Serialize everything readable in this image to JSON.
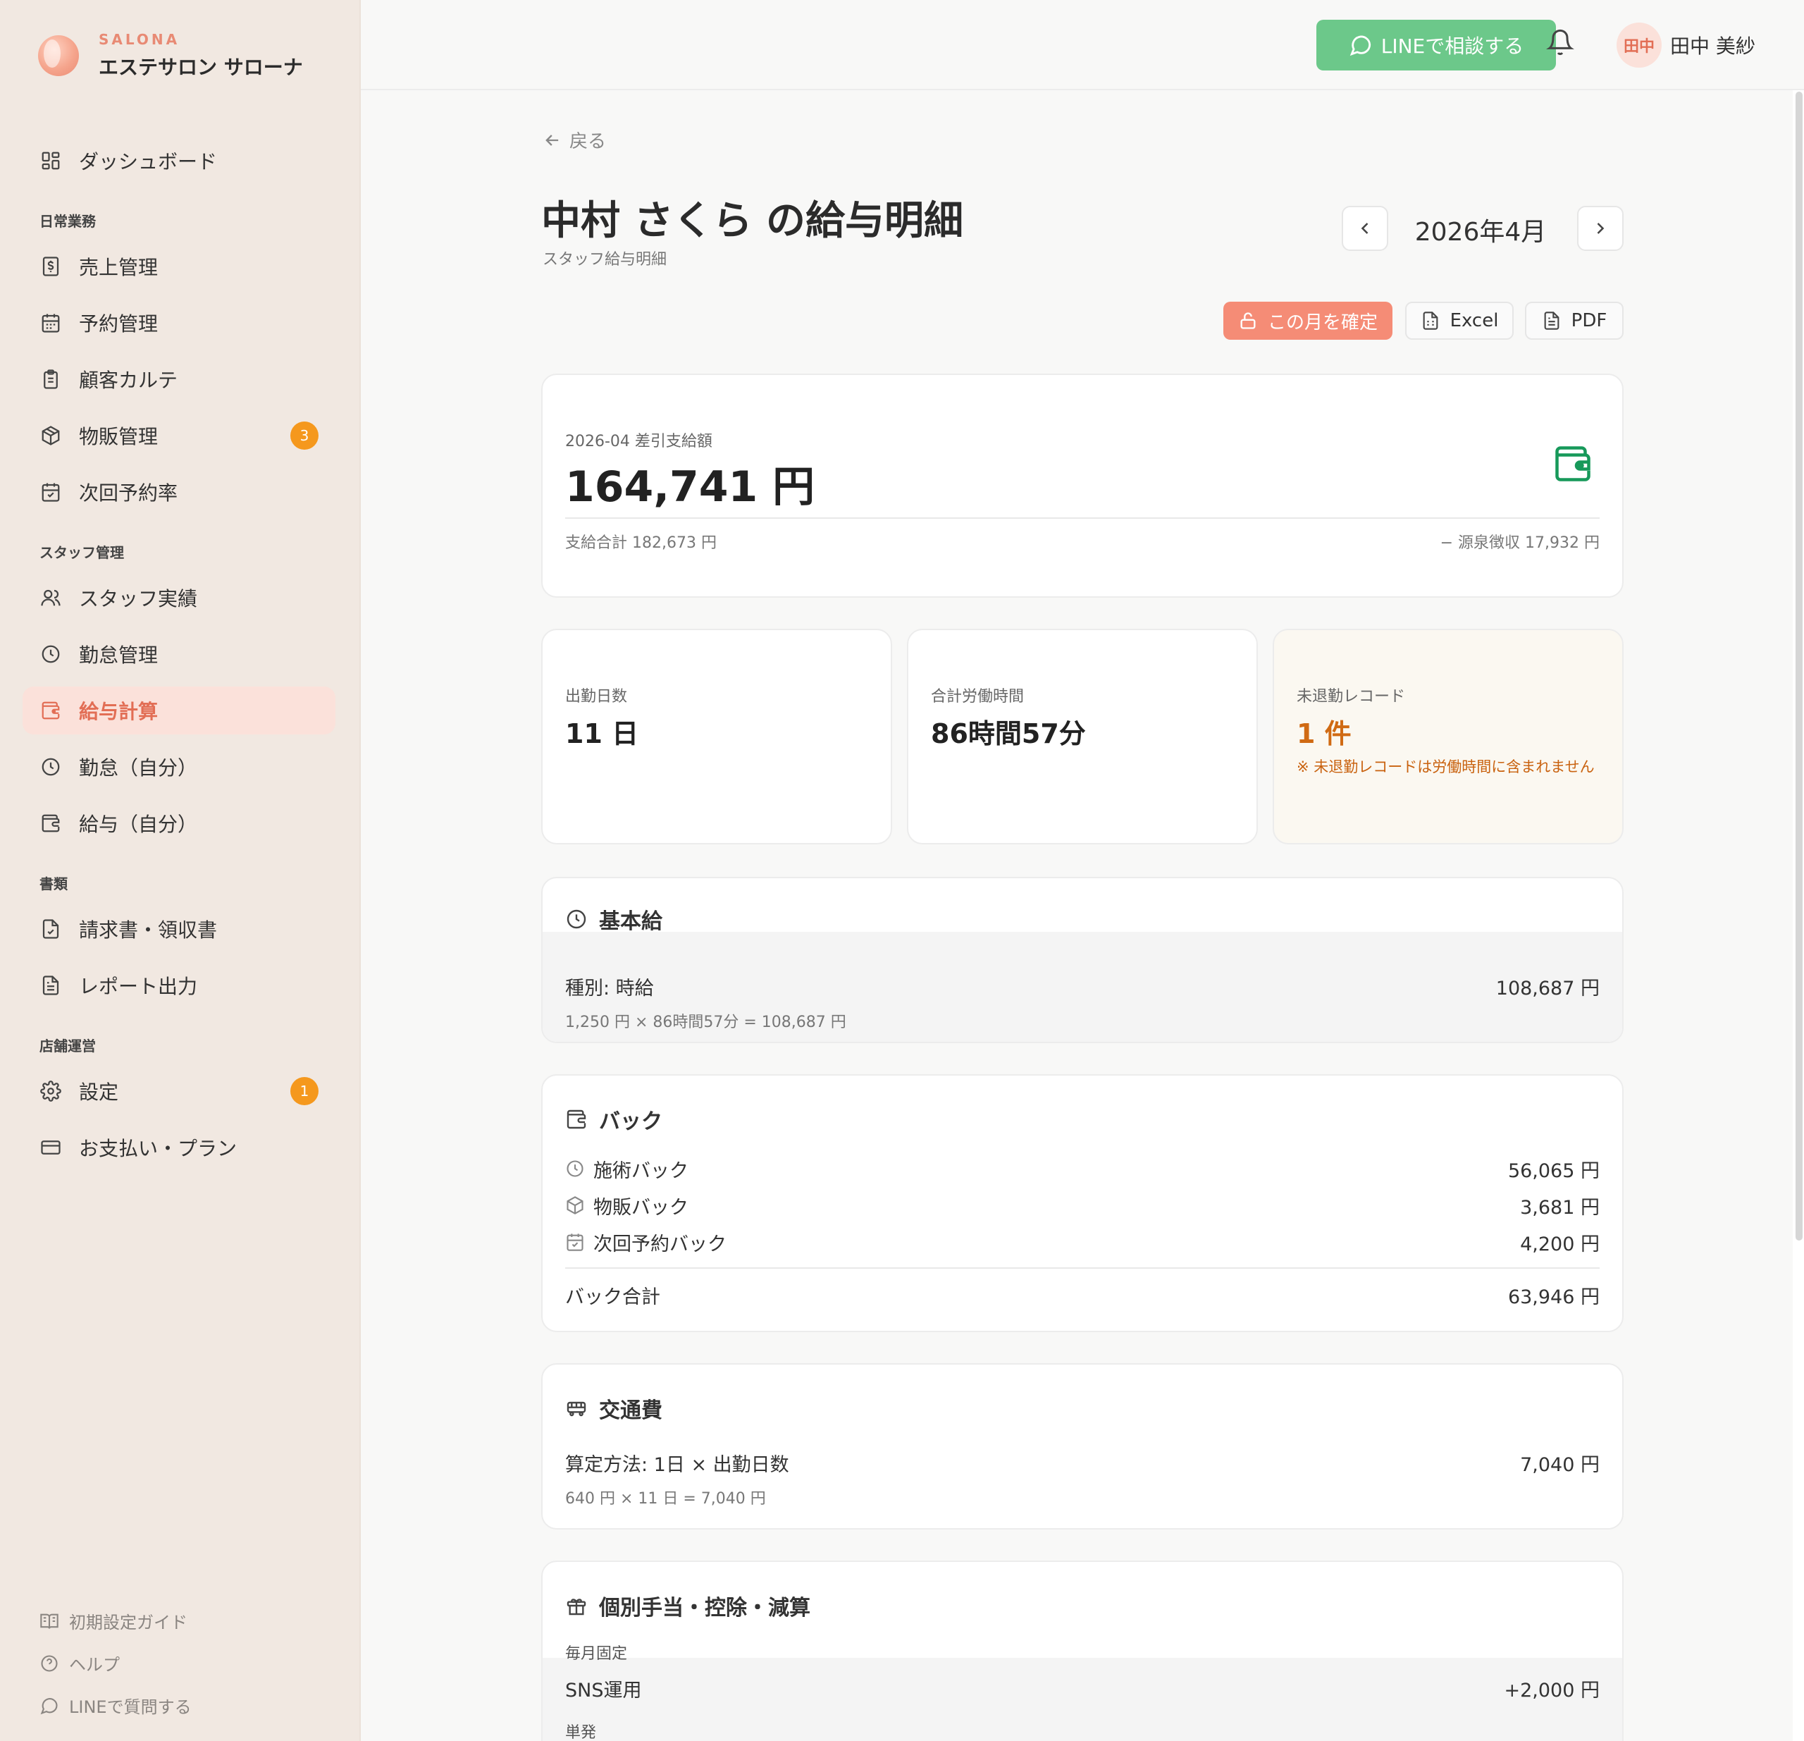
{
  "colors": {
    "accent": "#e26e55",
    "line_green": "#6cc88a",
    "badge": "#f5981d",
    "warn": "#d06a13"
  },
  "brand": {
    "small": "SALONA",
    "name": "エステサロン サローナ"
  },
  "nav": {
    "dashboard": "ダッシュボード",
    "section_daily": "日常業務",
    "sales": "売上管理",
    "reservations": "予約管理",
    "karte": "顧客カルテ",
    "merch": "物販管理",
    "merch_badge": "3",
    "next_rate": "次回予約率",
    "section_staff": "スタッフ管理",
    "staff_perf": "スタッフ実績",
    "attendance": "勤怠管理",
    "payroll": "給与計算",
    "attendance_self": "勤怠（自分）",
    "payroll_self": "給与（自分）",
    "section_docs": "書類",
    "invoices": "請求書・領収書",
    "reports": "レポート出力",
    "section_store": "店舗運営",
    "settings": "設定",
    "settings_badge": "1",
    "billing": "お支払い・プラン"
  },
  "footer": {
    "guide": "初期設定ガイド",
    "help": "ヘルプ",
    "line_ask": "LINEで質問する"
  },
  "topbar": {
    "line_button": "LINEで相談する",
    "avatar": "田中",
    "user_name": "田中 美紗"
  },
  "page": {
    "back": "戻る",
    "title": "中村 さくら の給与明細",
    "subtitle": "スタッフ給与明細",
    "month": "2026年4月",
    "confirm": "この月を確定",
    "excel": "Excel",
    "pdf": "PDF"
  },
  "net": {
    "label": "2026-04 差引支給額",
    "amount": "164,741 円",
    "gross": "支給合計 182,673 円",
    "tax": "− 源泉徴収 17,932 円"
  },
  "stats": {
    "days_label": "出勤日数",
    "days_value": "11 日",
    "hours_label": "合計労働時間",
    "hours_value": "86時間57分",
    "open_label": "未退勤レコード",
    "open_value": "1 件",
    "open_note": "※ 未退勤レコードは労働時間に含まれません"
  },
  "base": {
    "title": "基本給",
    "type_label": "種別: 時給",
    "amount": "108,687 円",
    "formula": "1,250 円 × 86時間57分 = 108,687 円"
  },
  "back_pay": {
    "title": "バック",
    "items": [
      {
        "label": "施術バック",
        "value": "56,065 円"
      },
      {
        "label": "物販バック",
        "value": "3,681 円"
      },
      {
        "label": "次回予約バック",
        "value": "4,200 円"
      }
    ],
    "total_label": "バック合計",
    "total_value": "63,946 円"
  },
  "transport": {
    "title": "交通費",
    "method": "算定方法: 1日 × 出勤日数",
    "amount": "7,040 円",
    "formula": "640 円 × 11 日 = 7,040 円"
  },
  "allowance": {
    "title": "個別手当・控除・減算",
    "fixed_label": "毎月固定",
    "sns_label": "SNS運用",
    "sns_value": "+2,000 円",
    "single_label": "単発"
  }
}
